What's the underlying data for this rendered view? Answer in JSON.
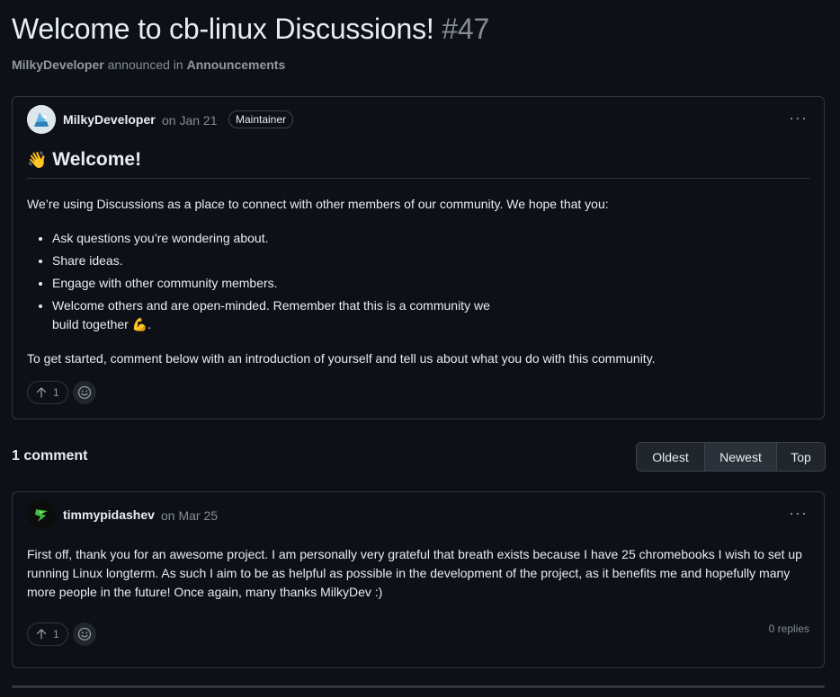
{
  "header": {
    "title": "Welcome to cb-linux Discussions!",
    "number": "#47",
    "author": "MilkyDeveloper",
    "announced_text": "announced in",
    "category": "Announcements"
  },
  "post": {
    "author": "MilkyDeveloper",
    "date": "on Jan 21",
    "badge": "Maintainer",
    "menu": "···",
    "heading_emoji": "👋",
    "heading": "Welcome!",
    "intro": "We’re using Discussions as a place to connect with other members of our community. We hope that you:",
    "bullets": [
      "Ask questions you’re wondering about.",
      "Share ideas.",
      "Engage with other community members.",
      "Welcome others and are open-minded. Remember that this is a community we build together 💪."
    ],
    "closing": "To get started, comment below with an introduction of yourself and tell us about what you do with this community.",
    "upvotes": "1"
  },
  "comments_section": {
    "count_label": "1 comment",
    "sort_options": [
      "Oldest",
      "Newest",
      "Top"
    ],
    "active_sort": "Newest"
  },
  "comment": {
    "author": "timmypidashev",
    "date": "on Mar 25",
    "menu": "···",
    "body": "First off, thank you for an awesome project. I am personally very grateful that breath exists because I have 25 chromebooks I wish to set up running Linux longterm. As such I aim to be as helpful as possible in the development of the project, as it benefits me and hopefully many more people in the future! Once again, many thanks MilkyDev :)",
    "upvotes": "1",
    "replies": "0 replies"
  },
  "icons": {
    "upvote": "arrow-up-icon",
    "reaction": "smiley-icon",
    "menu": "kebab-horizontal-icon"
  },
  "colors": {
    "background": "#0d1117",
    "border": "#30363d",
    "text": "#e6edf3",
    "muted": "#848d97"
  }
}
